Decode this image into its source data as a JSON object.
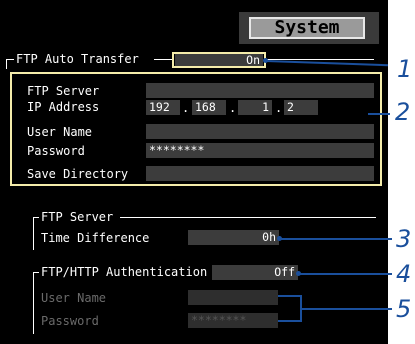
{
  "header": {
    "system_tab": "System"
  },
  "ftp_auto_transfer": {
    "label": "FTP Auto Transfer",
    "value": "On"
  },
  "ftp_settings": {
    "server_label": "FTP Server",
    "ip_label": "IP Address",
    "ip": [
      "192",
      "168",
      "1",
      "2"
    ],
    "user_label": "User Name",
    "user_value": "",
    "password_label": "Password",
    "password_value": "********",
    "save_dir_label": "Save Directory",
    "save_dir_value": ""
  },
  "ftp_server_group": {
    "title": "FTP Server",
    "time_diff_label": "Time Difference",
    "time_diff_value": "0h"
  },
  "auth_group": {
    "title": "FTP/HTTP Authentication",
    "value": "Off",
    "user_label": "User Name",
    "password_label": "Password",
    "password_value": "********"
  },
  "callouts": [
    "1",
    "2",
    "3",
    "4",
    "5"
  ],
  "colors": {
    "highlight_border": "#f4ecaa",
    "callout": "#1a4f9c",
    "field_bg": "#3c3c3c"
  }
}
